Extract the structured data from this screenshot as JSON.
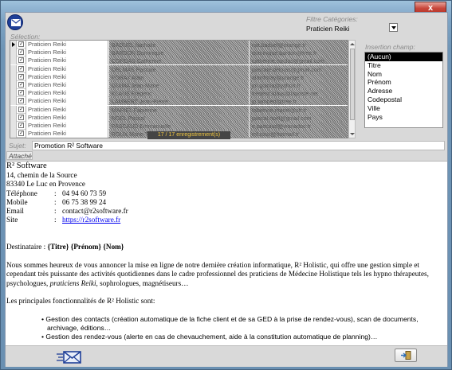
{
  "window": {
    "close_label": "x"
  },
  "filter": {
    "label": "Filtre Catégories:",
    "value": "Praticien Reiki"
  },
  "selection": {
    "label": "Sélection:"
  },
  "grid": {
    "rows": [
      {
        "checked": true,
        "category": "Praticien Reiki",
        "name": "BADUEL Nathalie",
        "email": "nat.baduel@orange.fr"
      },
      {
        "checked": true,
        "category": "Praticien Reiki",
        "name": "BARDON Dominique",
        "email": "dominique.bardon@free.fr"
      },
      {
        "checked": true,
        "category": "Praticien Reiki",
        "name": "CORDAS Catherine",
        "email": "catherine.cordas@gmail.com"
      },
      {
        "checked": true,
        "category": "Praticien Reiki",
        "name": "DELMAS Pascale",
        "email": "pascale.delmas@gmail.com"
      },
      {
        "checked": true,
        "category": "Praticien Reiki",
        "name": "FORAY Alain",
        "email": "alainforay@orange.fr"
      },
      {
        "checked": true,
        "category": "Praticien Reiki",
        "name": "GUIMA Jean-Marie",
        "email": "jm.guima@yahoo.fr"
      },
      {
        "checked": true,
        "category": "Praticien Reiki",
        "name": "KLAUS Frederic",
        "email": "frederic.klaus@laposte.net"
      },
      {
        "checked": true,
        "category": "Praticien Reiki",
        "name": "LAMBERT Jean-Pierre",
        "email": "jp.lambert@free.fr"
      },
      {
        "checked": true,
        "category": "Praticien Reiki",
        "name": "MARIEL Fabienne",
        "email": "fabienne.mariel@sfr.fr"
      },
      {
        "checked": true,
        "category": "Praticien Reiki",
        "name": "NOEL Pascal",
        "email": "pascal.noel@gmail.com"
      },
      {
        "checked": true,
        "category": "Praticien Reiki",
        "name": "PASCAUD Emmanuelle",
        "email": "e.pascaud@wanadoo.fr"
      },
      {
        "checked": true,
        "category": "Praticien Reiki",
        "name": "ROUX Marie-Therese",
        "email": "mt.roux@hotmail.fr"
      }
    ],
    "record_count": "17 / 17 enregistrement(s)"
  },
  "insert_field": {
    "label": "Insertion champ:",
    "items": [
      "(Aucun)",
      "Titre",
      "Nom",
      "Prénom",
      "Adresse",
      "Codepostal",
      "Ville",
      "Pays"
    ],
    "selected_index": 0
  },
  "subject": {
    "label": "Sujet:",
    "value": "Promotion R² Software"
  },
  "attach": {
    "label": "Attaché"
  },
  "body": {
    "brand": "R² Software",
    "address1": "14, chemin de la Source",
    "address2": "83340 Le Luc en Provence",
    "phone_label": "Téléphone",
    "phone_sep": ":",
    "phone_value": "04 94 60 73 59",
    "mobile_label": "Mobile",
    "mobile_sep": ":",
    "mobile_value": "06 75 38 99 24",
    "email_label": "Email",
    "email_sep": ":",
    "email_value": "contact@r2software.fr",
    "site_label": "Site",
    "site_sep": ":",
    "site_value": "https://r2software.fr",
    "dest_label": "Destinataire  :",
    "dest_fields": "{Titre} {Prénom} {Nom}",
    "para1_a": "Nous sommes heureux de vous annoncer la mise en ligne de notre dernière création informatique, R² Holistic, qui offre une gestion simple et cependant très puissante des activités quotidiennes dans le cadre professionnel des praticiens de Médecine Holistique tels les hypno thérapeutes, psychologues, ",
    "para1_italic": "praticiens Reiki",
    "para1_b": ", sophrologues, magnétiseurs…",
    "para2": "Les principales fonctionnalités de R² Holistic sont:",
    "bullet1": "Gestion des contacts (création automatique de la fiche client et de sa GED à la prise de rendez-vous), scan de documents, archivage, éditions…",
    "bullet2": "Gestion des rendez-vous (alerte en cas de chevauchement, aide à la constitution automatique de planning)…"
  },
  "icons": {
    "app": "envelope-icon",
    "send": "send-mail-icon",
    "exit": "exit-door-icon"
  }
}
